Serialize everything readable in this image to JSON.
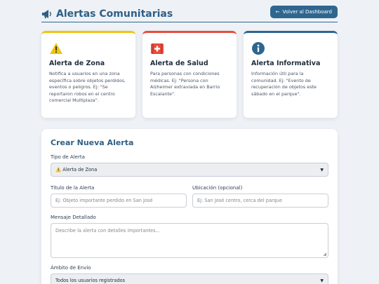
{
  "header": {
    "title": "Alertas Comunitarias",
    "back_button": "Volver al Dashboard"
  },
  "cards": [
    {
      "title": "Alerta de Zona",
      "description": "Notifica a usuarios en una zona específica sobre objetos perdidos, eventos o peligros. Ej: \"Se reportaron robos en el centro comercial Multiplaza\".",
      "icon": "warning-icon",
      "accent": "#f1c40f"
    },
    {
      "title": "Alerta de Salud",
      "description": "Para personas con condiciones médicas. Ej: \"Persona con Alzheimer extraviada en Barrio Escalante\".",
      "icon": "medical-icon",
      "accent": "#e74c3c"
    },
    {
      "title": "Alerta Informativa",
      "description": "Información útil para la comunidad. Ej: \"Evento de recuperación de objetos este sábado en el parque\".",
      "icon": "info-icon",
      "accent": "#2f6690"
    }
  ],
  "form": {
    "title": "Crear Nueva Alerta",
    "type_label": "Tipo de Alerta",
    "type_value": "⚠️ Alerta de Zona",
    "title_label": "Título de la Alerta",
    "title_placeholder": "Ej: Objeto importante perdido en San José",
    "location_label": "Ubicación (opcional)",
    "location_placeholder": "Ej: San José centro, cerca del parque",
    "message_label": "Mensaje Detallado",
    "message_placeholder": "Describe la alerta con detalles importantes...",
    "scope_label": "Ámbito de Envío",
    "scope_value": "Todos los usuarios registrados"
  }
}
